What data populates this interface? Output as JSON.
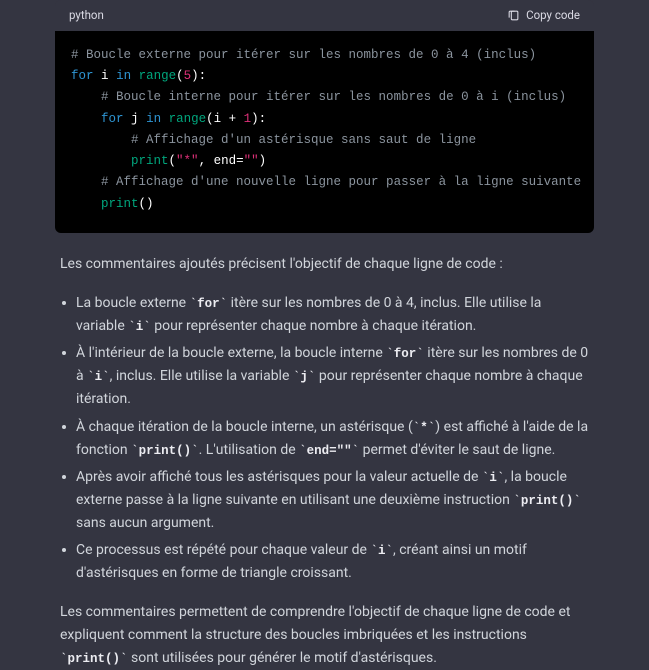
{
  "code_block": {
    "language": "python",
    "copy_label": "Copy code",
    "lines": {
      "c1": "# Boucle externe pour itérer sur les nombres de 0 à 4 (inclus)",
      "l2_for": "for",
      "l2_i": "i",
      "l2_in": "in",
      "l2_range": "range",
      "l2_open": "(",
      "l2_num": "5",
      "l2_close": "):",
      "c3": "# Boucle interne pour itérer sur les nombres de 0 à i (inclus)",
      "l4_for": "for",
      "l4_j": "j",
      "l4_in": "in",
      "l4_range": "range",
      "l4_open": "(i + ",
      "l4_num": "1",
      "l4_close": "):",
      "c5": "# Affichage d'un astérisque sans saut de ligne",
      "l6_print": "print",
      "l6_open": "(",
      "l6_str": "\"*\"",
      "l6_comma": ", end=",
      "l6_empty": "\"\"",
      "l6_close": ")",
      "c7": "# Affichage d'une nouvelle ligne pour passer à la ligne suivante",
      "l8_print": "print",
      "l8_parens": "()"
    }
  },
  "explanation": {
    "intro": "Les commentaires ajoutés précisent l'objectif de chaque ligne de code :",
    "bullets": [
      {
        "pre": "La boucle externe ",
        "c1": "for",
        "mid1": " itère sur les nombres de 0 à 4, inclus. Elle utilise la variable ",
        "c2": "i",
        "post": " pour représenter chaque nombre à chaque itération."
      },
      {
        "pre": "À l'intérieur de la boucle externe, la boucle interne ",
        "c1": "for",
        "mid1": " itère sur les nombres de 0 à ",
        "c2": "i",
        "mid2": ", inclus. Elle utilise la variable ",
        "c3": "j",
        "post": " pour représenter chaque nombre à chaque itération."
      },
      {
        "pre": "À chaque itération de la boucle interne, un astérisque (",
        "c1": "*",
        "mid1": ") est affiché à l'aide de la fonction ",
        "c2": "print()",
        "mid2": ". L'utilisation de ",
        "c3": "end=\"\"",
        "post": " permet d'éviter le saut de ligne."
      },
      {
        "pre": "Après avoir affiché tous les astérisques pour la valeur actuelle de ",
        "c1": "i",
        "mid1": ", la boucle externe passe à la ligne suivante en utilisant une deuxième instruction ",
        "c2": "print()",
        "post": " sans aucun argument."
      },
      {
        "pre": "Ce processus est répété pour chaque valeur de ",
        "c1": "i",
        "post": ", créant ainsi un motif d'astérisques en forme de triangle croissant."
      }
    ],
    "outro_1": "Les commentaires permettent de comprendre l'objectif de chaque ligne de code et expliquent comment la structure des boucles imbriquées et les instructions ",
    "outro_code": "print()",
    "outro_2": " sont utilisées pour générer le motif d'astérisques."
  }
}
